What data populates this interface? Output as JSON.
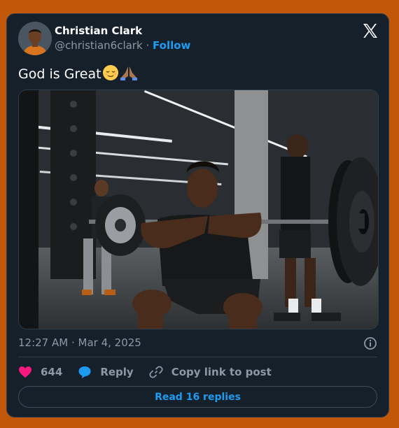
{
  "author": {
    "name": "Christian Clark",
    "handle": "@christian6clark",
    "separator": "·",
    "follow_label": "Follow"
  },
  "tweet": {
    "text": "God is Great",
    "emojis": [
      "relieved-face",
      "folded-hands"
    ],
    "timestamp": "12:27 AM · Mar 4, 2025"
  },
  "actions": {
    "likes": "644",
    "reply_label": "Reply",
    "copy_label": "Copy link to post"
  },
  "read_replies_label": "Read 16 replies",
  "icons": [
    "x-logo-icon",
    "info-icon",
    "heart-icon",
    "reply-bubble-icon",
    "link-icon"
  ],
  "colors": {
    "page_bg": "#c2570a",
    "card_bg": "#15202b",
    "accent": "#1d9bf0",
    "like": "#f91880",
    "muted": "#8b98a5"
  }
}
